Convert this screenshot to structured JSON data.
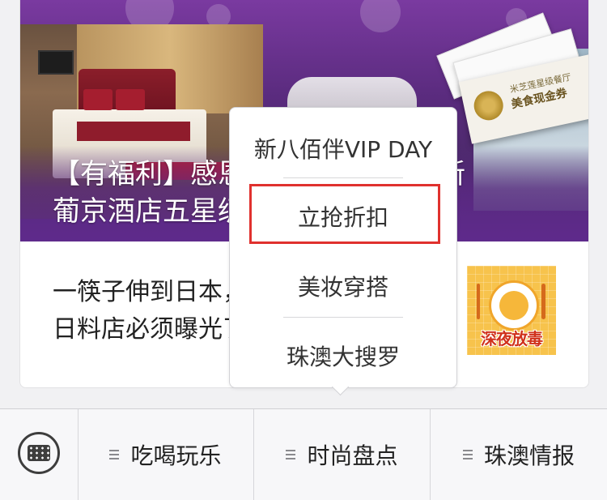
{
  "banner": {
    "title_line1": "【有福利】感恩回馈读者，送您新",
    "title_line2": "葡京酒店五星级晚宴+米芝莲…",
    "ticket_line1": "米芝莲星级餐厅",
    "ticket_line2": "美食现金券"
  },
  "article": {
    "title_line1": "一筷子伸到日本，这些珠澳",
    "title_line2": "日料店必须曝光了！",
    "thumb_text": "深夜放毒"
  },
  "popup_menu": {
    "items": [
      {
        "label": "新八佰伴VIP DAY"
      },
      {
        "label": "立抢折扣"
      },
      {
        "label": "美妆穿搭"
      },
      {
        "label": "珠澳大搜罗"
      }
    ],
    "highlighted_index": 1,
    "highlight_color": "#e0312e"
  },
  "tabbar": {
    "keyboard_icon": "keyboard-icon",
    "tabs": [
      {
        "label": "吃喝玩乐"
      },
      {
        "label": "时尚盘点"
      },
      {
        "label": "珠澳情报"
      }
    ]
  }
}
